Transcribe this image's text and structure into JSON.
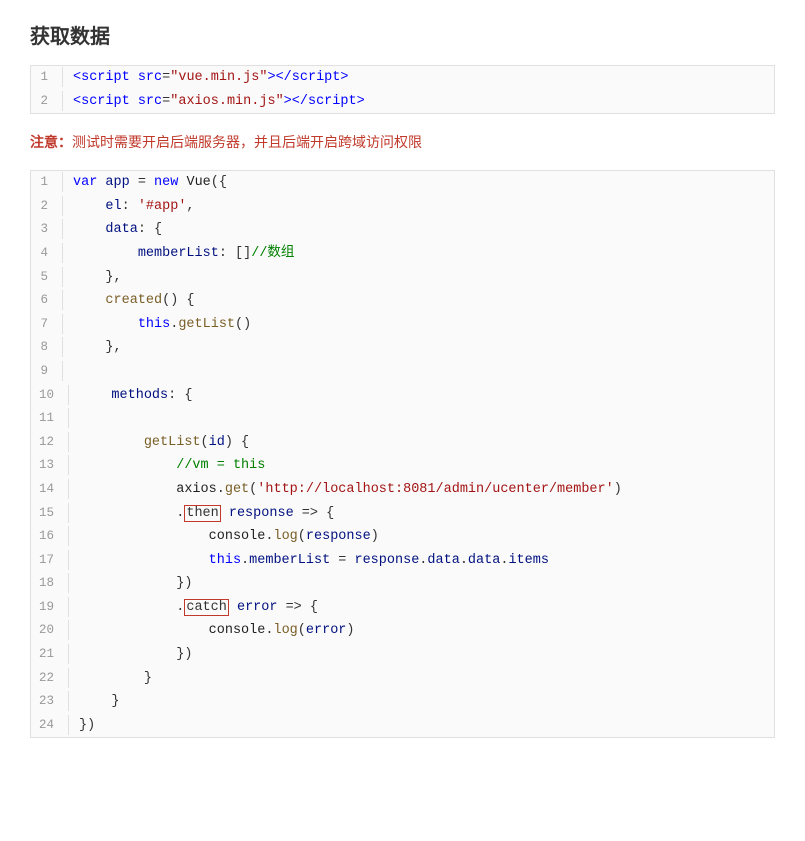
{
  "page": {
    "title": "获取数据",
    "note": "注意：测试时需要开启后端服务器，并且后端开启跨域访问权限"
  },
  "block1": {
    "lines": [
      {
        "num": "1",
        "code": "<script src=\"vue.min.js\"></script>"
      },
      {
        "num": "2",
        "code": "<script src=\"axios.min.js\"></script>"
      }
    ]
  },
  "block2": {
    "lines": [
      {
        "num": "1"
      },
      {
        "num": "2"
      },
      {
        "num": "3"
      },
      {
        "num": "4"
      },
      {
        "num": "5"
      },
      {
        "num": "6"
      },
      {
        "num": "7"
      },
      {
        "num": "8"
      },
      {
        "num": "9"
      },
      {
        "num": "10"
      },
      {
        "num": "11"
      },
      {
        "num": "12"
      },
      {
        "num": "13"
      },
      {
        "num": "14"
      },
      {
        "num": "15"
      },
      {
        "num": "16"
      },
      {
        "num": "17"
      },
      {
        "num": "18"
      },
      {
        "num": "19"
      },
      {
        "num": "20"
      },
      {
        "num": "21"
      },
      {
        "num": "22"
      },
      {
        "num": "23"
      },
      {
        "num": "24"
      }
    ]
  }
}
